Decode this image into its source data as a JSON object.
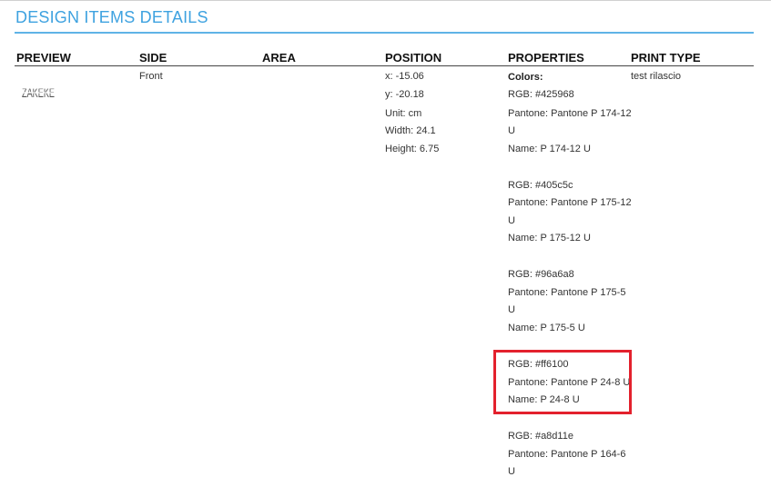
{
  "page": {
    "title": "DESIGN ITEMS DETAILS"
  },
  "table": {
    "headers": {
      "preview": "PREVIEW",
      "side": "SIDE",
      "area": "AREA",
      "position": "POSITION",
      "properties": "PROPERTIES",
      "print_type": "PRINT TYPE"
    },
    "row": {
      "preview_logo_text": "ZAKEKE",
      "side": "Front",
      "position": {
        "x": "x: -15.06",
        "y": "y: -20.18",
        "unit": "Unit: cm",
        "width": "Width: 24.1",
        "height": "Height: 6.75"
      },
      "properties": {
        "colors_label": "Colors:",
        "c1_rgb": "RGB: #425968",
        "c1_pantone_a": "Pantone: Pantone P 174-12",
        "c1_pantone_b": "U",
        "c1_name": "Name: P 174-12 U",
        "c2_rgb": "RGB: #405c5c",
        "c2_pantone_a": "Pantone: Pantone P 175-12",
        "c2_pantone_b": "U",
        "c2_name": "Name: P 175-12 U",
        "c3_rgb": "RGB: #96a6a8",
        "c3_pantone_a": "Pantone: Pantone P 175-5",
        "c3_pantone_b": "U",
        "c3_name": "Name: P 175-5 U",
        "c4_rgb": "RGB: #ff6100",
        "c4_pantone": "Pantone: Pantone P 24-8 U",
        "c4_name": "Name: P 24-8 U",
        "c5_rgb": "RGB: #a8d11e",
        "c5_pantone_a": "Pantone: Pantone P 164-6",
        "c5_pantone_b": "U"
      },
      "print_type": "test rilascio"
    }
  },
  "colors": {
    "title": "#3ea2e0",
    "highlight_box": "#e3212d"
  }
}
